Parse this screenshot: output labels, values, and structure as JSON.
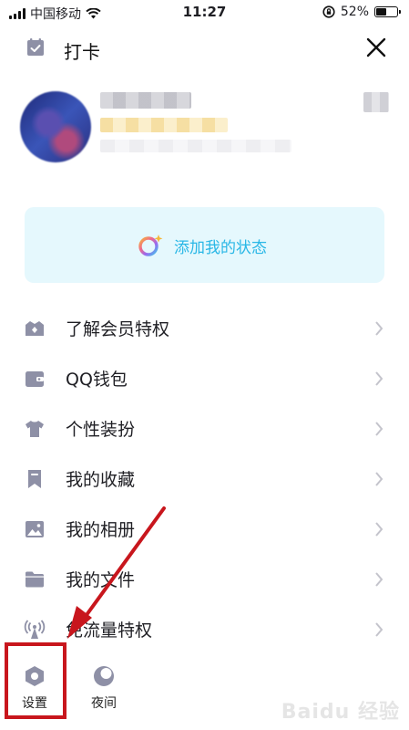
{
  "status_bar": {
    "carrier": "中国移动",
    "time": "11:27",
    "battery_text": "52%",
    "battery_level": 0.52
  },
  "header": {
    "title": "打卡"
  },
  "status_card": {
    "label": "添加我的状态"
  },
  "menu": {
    "items": [
      {
        "label": "了解会员特权",
        "icon": "vip-crown-icon"
      },
      {
        "label": "QQ钱包",
        "icon": "wallet-icon"
      },
      {
        "label": "个性装扮",
        "icon": "tshirt-icon"
      },
      {
        "label": "我的收藏",
        "icon": "bookmark-icon"
      },
      {
        "label": "我的相册",
        "icon": "photo-icon"
      },
      {
        "label": "我的文件",
        "icon": "folder-icon"
      },
      {
        "label": "免流量特权",
        "icon": "signal-tower-icon"
      }
    ]
  },
  "bottom": {
    "settings_label": "设置",
    "night_label": "夜间"
  },
  "watermark": "Baidu 经验",
  "colors": {
    "accent": "#29b7e6",
    "icon_gray": "#8e90a6",
    "highlight": "#c8161d",
    "card_bg": "#e5f8fd"
  }
}
